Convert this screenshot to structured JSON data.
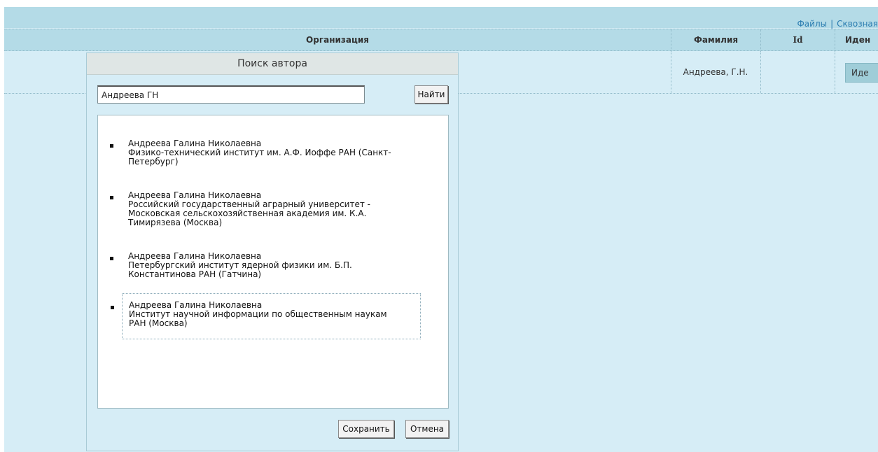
{
  "toplinks": {
    "files": "Файлы",
    "separator": "|",
    "crosscut": "Сквозная"
  },
  "table": {
    "headers": {
      "organization": "Организация",
      "surname": "Фамилия",
      "id": "Id",
      "identify": "Иден"
    },
    "row": {
      "surname": "Андреева, Г.Н.",
      "identify_button": "Иде"
    }
  },
  "dialog": {
    "title": "Поиск автора",
    "search_value": "Андреева ГН",
    "find_button": "Найти",
    "save_button": "Сохранить",
    "cancel_button": "Отмена",
    "results": [
      {
        "name": "Андреева Галина Николаевна",
        "org_line1": "Физико-технический институт им. А.Ф. Иоффе РАН (Санкт-",
        "org_line2": "Петербург)",
        "org_line3": ""
      },
      {
        "name": "Андреева Галина Николаевна",
        "org_line1": "Российский государственный аграрный университет -",
        "org_line2": "Московская сельскохозяйственная академия им. К.А.",
        "org_line3": "Тимирязева (Москва)"
      },
      {
        "name": "Андреева Галина Николаевна",
        "org_line1": "Петербургский институт ядерной физики им. Б.П.",
        "org_line2": "Константинова РАН (Гатчина)",
        "org_line3": ""
      },
      {
        "name": "Андреева Галина Николаевна",
        "org_line1": "Институт научной информации по общественным наукам",
        "org_line2": "РАН (Москва)",
        "org_line3": ""
      }
    ]
  }
}
